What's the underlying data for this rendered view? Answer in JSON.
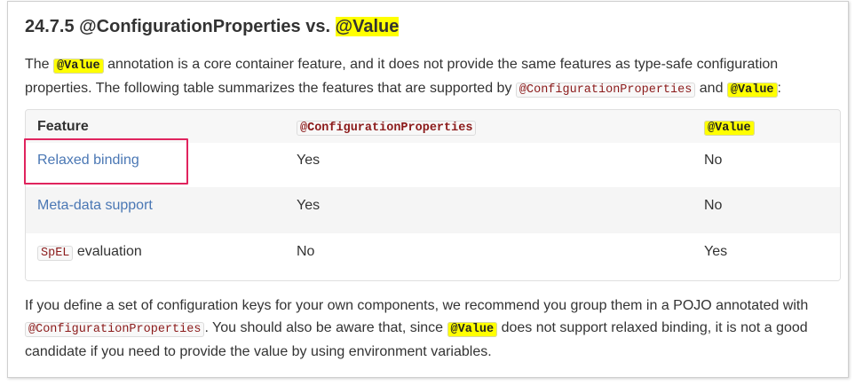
{
  "heading": {
    "prefix": "24.7.5 @ConfigurationProperties vs. ",
    "highlight": "@Value"
  },
  "intro": {
    "t1": "The ",
    "code1": "@Value",
    "t2": " annotation is a core container feature, and it does not provide the same features as type-safe configuration properties. The following table summarizes the features that are supported by ",
    "code2": "@ConfigurationProperties",
    "t3": " and ",
    "code3": "@Value",
    "t4": ":"
  },
  "table": {
    "headers": [
      "Feature",
      "@ConfigurationProperties",
      "@Value"
    ],
    "rows": [
      {
        "feature": "Relaxed binding",
        "config_props": "Yes",
        "value": "No"
      },
      {
        "feature": "Meta-data support",
        "config_props": "Yes",
        "value": "No"
      },
      {
        "feature_code": "SpEL",
        "feature_text": " evaluation",
        "config_props": "No",
        "value": "Yes"
      }
    ]
  },
  "outro": {
    "t1": "If you define a set of configuration keys for your own components, we recommend you group them in a POJO annotated with ",
    "code1": "@ConfigurationProperties",
    "t2": ". You should also be aware that, since ",
    "code2": "@Value",
    "t3": " does not support relaxed binding, it is not a good candidate if you need to provide the value by using environment variables."
  },
  "colors": {
    "highlight": "#ffff00",
    "link": "#4a77b4",
    "annotation_box": "#e0245e"
  }
}
